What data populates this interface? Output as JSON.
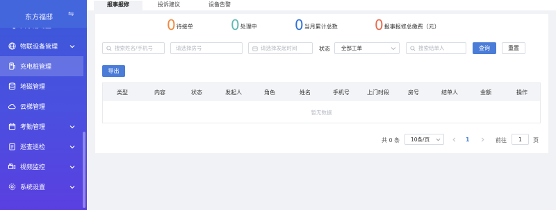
{
  "brand": {
    "title": "东方福邸",
    "toggle_icon": "swap-icon"
  },
  "sidebar": {
    "items": [
      {
        "label": "共享活动室",
        "icon": "share-icon",
        "has_children": false
      },
      {
        "label": "物联设备管理",
        "icon": "globe-icon",
        "has_children": true
      },
      {
        "label": "充电桩管理",
        "icon": "charger-icon",
        "has_children": false
      },
      {
        "label": "地磁管理",
        "icon": "database-icon",
        "has_children": false
      },
      {
        "label": "云梯管理",
        "icon": "cloud-icon",
        "has_children": false
      },
      {
        "label": "考勤管理",
        "icon": "calendar-icon",
        "has_children": true
      },
      {
        "label": "巡查巡检",
        "icon": "checklist-icon",
        "has_children": true
      },
      {
        "label": "视频监控",
        "icon": "video-icon",
        "has_children": true
      },
      {
        "label": "系统设置",
        "icon": "gear-icon",
        "has_children": true
      }
    ],
    "active_index": 2
  },
  "tabs": [
    {
      "label": "报事报修",
      "active": true
    },
    {
      "label": "投诉建议",
      "active": false
    },
    {
      "label": "设备告警",
      "active": false
    }
  ],
  "stats": [
    {
      "value": "0",
      "label": "待接单",
      "color": "#f0883e"
    },
    {
      "value": "0",
      "label": "处理中",
      "color": "#5fb8b0"
    },
    {
      "value": "0",
      "label": "当月累计总数",
      "color": "#2f6fd6"
    },
    {
      "value": "0",
      "label": "报事报修总缴费（元）",
      "color": "#e8694d"
    }
  ],
  "filters": {
    "name_phone_placeholder": "搜索姓名/手机号",
    "room_placeholder": "请选择房号",
    "date_placeholder": "请选择发起时间",
    "status_label": "状态",
    "status_value": "全部工单",
    "handler_placeholder": "搜索结单人",
    "query_button": "查询",
    "reset_button": "重置"
  },
  "export_button": "导出",
  "table": {
    "columns": [
      "类型",
      "内容",
      "状态",
      "发起人",
      "角色",
      "姓名",
      "手机号",
      "上门时段",
      "房号",
      "结单人",
      "金额",
      "操作"
    ],
    "empty_text": "暂无数据"
  },
  "pagination": {
    "total_text": "共 0 条",
    "page_size": "10条/页",
    "current_page": "1",
    "goto_label": "前往",
    "goto_value": "1",
    "page_suffix": "页"
  },
  "colors": {
    "primary": "#4a7cd8",
    "sidebar_top": "#3a5ad8",
    "sidebar_bottom": "#5a3fe0"
  }
}
